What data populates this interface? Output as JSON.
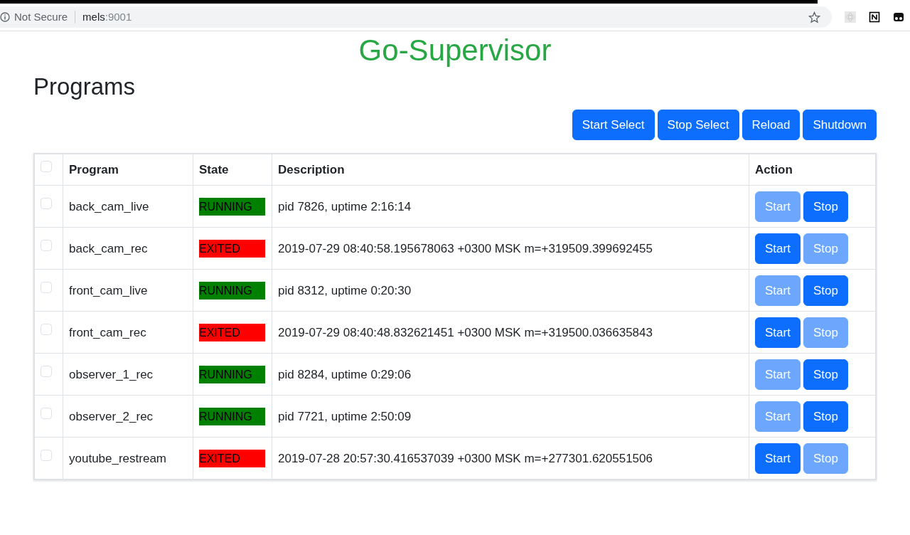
{
  "browser": {
    "security": "Not Secure",
    "host": "mels",
    "port": ":9001"
  },
  "title": "Go-Supervisor",
  "heading": "Programs",
  "toolbar": [
    "Start Select",
    "Stop Select",
    "Reload",
    "Shutdown"
  ],
  "table": {
    "columns": [
      "Program",
      "State",
      "Description",
      "Action"
    ],
    "header_checked": false,
    "rows": [
      {
        "checked": false,
        "program": "back_cam_live",
        "state": "RUNNING",
        "color": "#008000",
        "description": "pid 7826, uptime 2:16:14",
        "start": {
          "label": "Start",
          "disabled": true
        },
        "stop": {
          "label": "Stop",
          "disabled": false
        }
      },
      {
        "checked": false,
        "program": "back_cam_rec",
        "state": "EXITED",
        "color": "#ff0000",
        "description": "2019-07-29 08:40:58.195678063 +0300 MSK m=+319509.399692455",
        "start": {
          "label": "Start",
          "disabled": false
        },
        "stop": {
          "label": "Stop",
          "disabled": true
        }
      },
      {
        "checked": false,
        "program": "front_cam_live",
        "state": "RUNNING",
        "color": "#008000",
        "description": "pid 8312, uptime 0:20:30",
        "start": {
          "label": "Start",
          "disabled": true
        },
        "stop": {
          "label": "Stop",
          "disabled": false
        }
      },
      {
        "checked": false,
        "program": "front_cam_rec",
        "state": "EXITED",
        "color": "#ff0000",
        "description": "2019-07-29 08:40:48.832621451 +0300 MSK m=+319500.036635843",
        "start": {
          "label": "Start",
          "disabled": false
        },
        "stop": {
          "label": "Stop",
          "disabled": true
        }
      },
      {
        "checked": false,
        "program": "observer_1_rec",
        "state": "RUNNING",
        "color": "#008000",
        "description": "pid 8284, uptime 0:29:06",
        "start": {
          "label": "Start",
          "disabled": true
        },
        "stop": {
          "label": "Stop",
          "disabled": false
        }
      },
      {
        "checked": false,
        "program": "observer_2_rec",
        "state": "RUNNING",
        "color": "#008000",
        "description": "pid 7721, uptime 2:50:09",
        "start": {
          "label": "Start",
          "disabled": true
        },
        "stop": {
          "label": "Stop",
          "disabled": false
        }
      },
      {
        "checked": false,
        "program": "youtube_restream",
        "state": "EXITED",
        "color": "#ff0000",
        "description": "2019-07-28 20:57:30.416537039 +0300 MSK m=+277301.620551506",
        "start": {
          "label": "Start",
          "disabled": false
        },
        "stop": {
          "label": "Stop",
          "disabled": true
        }
      }
    ]
  }
}
